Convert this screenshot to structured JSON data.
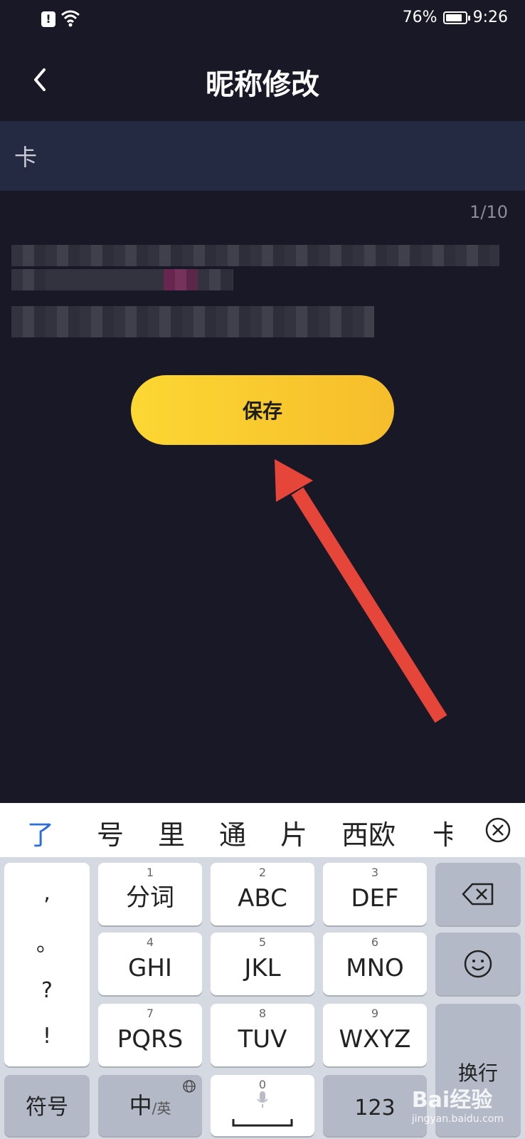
{
  "status_bar": {
    "battery": "76%",
    "time": "9:26"
  },
  "header": {
    "title": "昵称修改"
  },
  "nickname_input": {
    "value": "卡"
  },
  "counter": "1/10",
  "save_button": {
    "label": "保存"
  },
  "candidates": [
    "了",
    "号",
    "里",
    "通",
    "片",
    "西欧",
    "卡"
  ],
  "keyboard": {
    "punctuation": [
      ",",
      "。",
      "?",
      "!"
    ],
    "keys": [
      {
        "num": "1",
        "label": "分词"
      },
      {
        "num": "2",
        "label": "ABC"
      },
      {
        "num": "3",
        "label": "DEF"
      },
      {
        "num": "4",
        "label": "GHI"
      },
      {
        "num": "5",
        "label": "JKL"
      },
      {
        "num": "6",
        "label": "MNO"
      },
      {
        "num": "7",
        "label": "PQRS"
      },
      {
        "num": "8",
        "label": "TUV"
      },
      {
        "num": "9",
        "label": "WXYZ"
      }
    ],
    "symbols_label": "符号",
    "lang_label_main": "中",
    "lang_label_sub": "/英",
    "space_num": "0",
    "numbers_label": "123",
    "enter_label": "换行"
  },
  "watermark": {
    "brand": "Bai经验",
    "url": "jingyan.baidu.com"
  }
}
